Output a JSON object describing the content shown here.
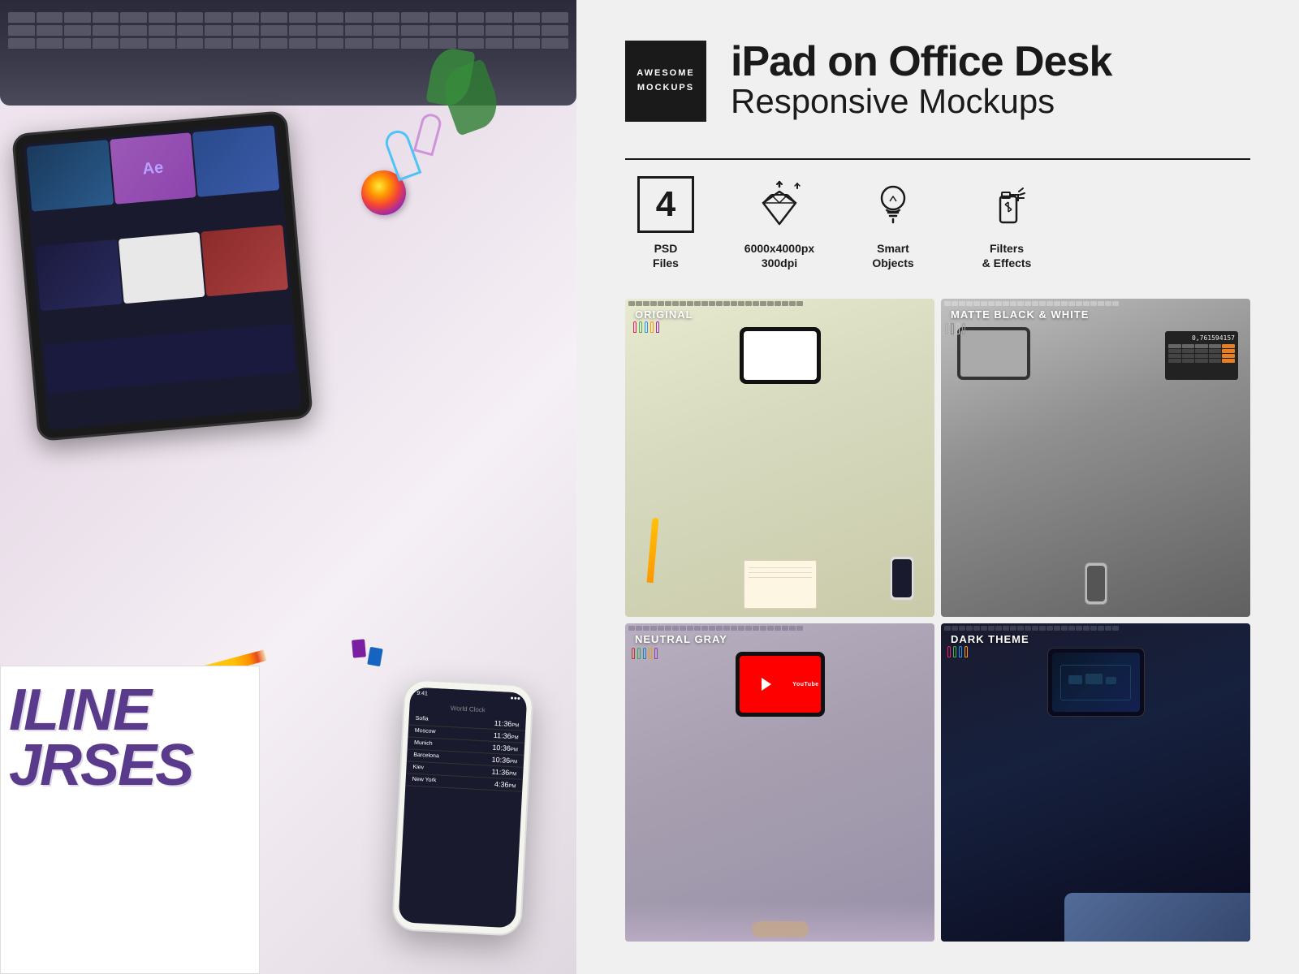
{
  "brand": {
    "logo_line1": "AWESOME",
    "logo_line2": "MOCKUPS"
  },
  "product": {
    "title_main": "iPad on Office Desk",
    "title_sub": "Responsive Mockups"
  },
  "features": [
    {
      "id": "psd",
      "number": "4",
      "label": "PSD\nFiles",
      "icon_type": "number-box"
    },
    {
      "id": "resolution",
      "label": "6000x4000px\n300dpi",
      "icon_type": "diamond"
    },
    {
      "id": "smart",
      "label": "Smart\nObjects",
      "icon_type": "lightbulb"
    },
    {
      "id": "filters",
      "label": "Filters\n& Effects",
      "icon_type": "bottle"
    }
  ],
  "previews": [
    {
      "id": "original",
      "label": "ORIGINAL",
      "theme": "original"
    },
    {
      "id": "matte-bw",
      "label": "MATTE BLACK & WHITE",
      "theme": "bw"
    },
    {
      "id": "neutral-gray",
      "label": "NEUTRAL GRAY",
      "theme": "gray"
    },
    {
      "id": "dark-theme",
      "label": "DARK THEME",
      "theme": "dark"
    }
  ],
  "ipad_cards": [
    "Ae",
    "photo",
    "dark"
  ],
  "phone_times": [
    {
      "city": "Sofia",
      "time": "11:36PM"
    },
    {
      "city": "Moscow",
      "time": "11:36PM"
    },
    {
      "city": "Munich",
      "time": "10:36PM"
    },
    {
      "city": "Barcelona",
      "time": "10:36PM"
    },
    {
      "city": "Kiev",
      "time": "11:36PM"
    },
    {
      "city": "New York",
      "time": "4:36PM"
    }
  ]
}
